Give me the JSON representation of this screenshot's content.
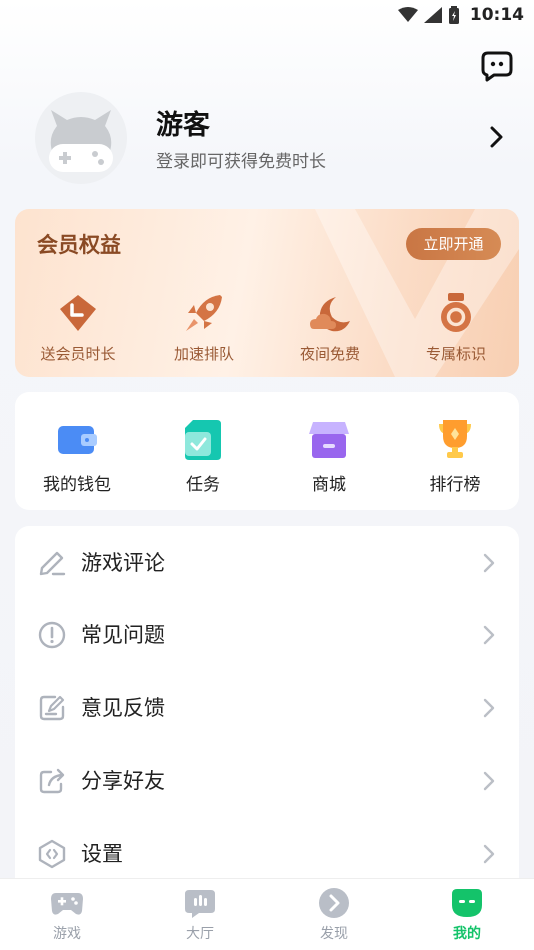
{
  "status_bar": {
    "time": "10:14"
  },
  "profile": {
    "name": "游客",
    "subtitle": "登录即可获得免费时长"
  },
  "member": {
    "title": "会员权益",
    "open_button": "立即开通",
    "items": [
      {
        "label": "送会员时长",
        "icon": "clock-tag-icon"
      },
      {
        "label": "加速排队",
        "icon": "rocket-icon"
      },
      {
        "label": "夜间免费",
        "icon": "moon-cloud-icon"
      },
      {
        "label": "专属标识",
        "icon": "medal-icon"
      }
    ]
  },
  "quick": {
    "items": [
      {
        "label": "我的钱包",
        "icon": "wallet-icon"
      },
      {
        "label": "任务",
        "icon": "task-icon"
      },
      {
        "label": "商城",
        "icon": "store-icon"
      },
      {
        "label": "排行榜",
        "icon": "trophy-icon"
      }
    ]
  },
  "menu": {
    "items": [
      {
        "label": "游戏评论",
        "icon": "pencil-icon"
      },
      {
        "label": "常见问题",
        "icon": "exclamation-circle-icon"
      },
      {
        "label": "意见反馈",
        "icon": "feedback-edit-icon"
      },
      {
        "label": "分享好友",
        "icon": "share-icon"
      },
      {
        "label": "设置",
        "icon": "settings-hexagon-icon"
      }
    ]
  },
  "nav": {
    "items": [
      {
        "label": "游戏",
        "icon": "gamepad-icon",
        "active": false
      },
      {
        "label": "大厅",
        "icon": "hall-icon",
        "active": false
      },
      {
        "label": "发现",
        "icon": "discover-icon",
        "active": false
      },
      {
        "label": "我的",
        "icon": "mine-face-icon",
        "active": true
      }
    ]
  },
  "colors": {
    "accent_green": "#14c36a",
    "member_brown": "#8a4a24",
    "member_button": "#cf7f4b"
  }
}
